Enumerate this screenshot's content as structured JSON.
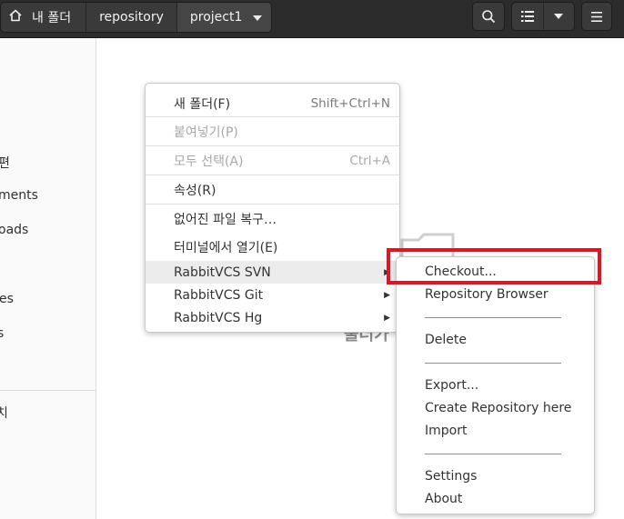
{
  "header": {
    "breadcrumbs": [
      "내 폴더",
      "repository",
      "project1"
    ],
    "icons": [
      "home-icon",
      "chevron-down-icon",
      "search-icon",
      "list-view-icon",
      "chevron-down-icon",
      "hamburger-menu-icon"
    ]
  },
  "sidebar": {
    "items": [
      "편",
      "ments",
      "oads",
      "es",
      "s",
      "치"
    ]
  },
  "background": {
    "empty_text_fragment": "둘더가"
  },
  "context_menu": {
    "items": [
      {
        "label": "새 폴더(F)",
        "accel": "Shift+Ctrl+N",
        "enabled": true
      },
      {
        "label": "붙여넣기(P)",
        "accel": "",
        "enabled": false
      },
      {
        "label": "모두 선택(A)",
        "accel": "Ctrl+A",
        "enabled": false
      },
      {
        "label": "속성(R)",
        "accel": "",
        "enabled": true
      },
      {
        "label": "없어진 파일 복구…",
        "accel": "",
        "enabled": true
      },
      {
        "label": "터미널에서 열기(E)",
        "accel": "",
        "enabled": true
      },
      {
        "label": "RabbitVCS SVN",
        "accel": "",
        "enabled": true,
        "submenu": true,
        "highlighted": true
      },
      {
        "label": "RabbitVCS Git",
        "accel": "",
        "enabled": true,
        "submenu": true
      },
      {
        "label": "RabbitVCS Hg",
        "accel": "",
        "enabled": true,
        "submenu": true
      }
    ]
  },
  "svn_submenu": {
    "items": [
      "Checkout...",
      "Repository Browser",
      "Delete",
      "Export...",
      "Create Repository here",
      "Import",
      "Settings",
      "About"
    ]
  },
  "colors": {
    "header_bg": "#2c2c2c",
    "highlight_box": "#e3141f",
    "menu_highlight": "#ececec"
  }
}
